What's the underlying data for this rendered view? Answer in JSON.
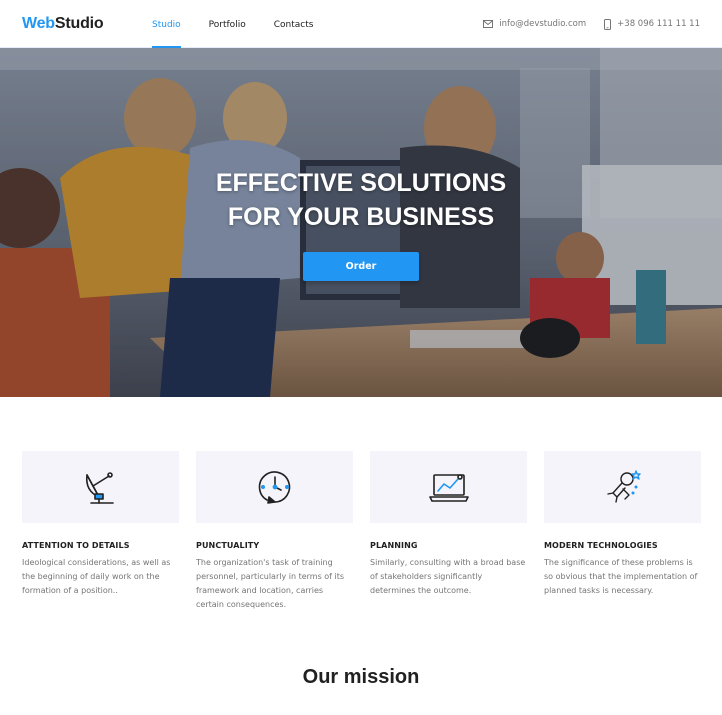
{
  "header": {
    "logo_web": "Web",
    "logo_studio": "Studio",
    "nav": [
      {
        "label": "Studio",
        "active": true
      },
      {
        "label": "Portfolio",
        "active": false
      },
      {
        "label": "Contacts",
        "active": false
      }
    ],
    "email": "info@devstudio.com",
    "phone": "+38 096 111 11 11"
  },
  "hero": {
    "title_line1": "EFFECTIVE SOLUTIONS",
    "title_line2": "FOR YOUR BUSINESS",
    "button_label": "Order"
  },
  "features": [
    {
      "icon": "satellite-dish-icon",
      "title": "ATTENTION TO DETAILS",
      "text": "Ideological considerations, as well as the beginning of daily work on the formation of a position.."
    },
    {
      "icon": "clock-icon",
      "title": "PUNCTUALITY",
      "text": "The organization's task of training personnel, particularly in terms of its framework and location, carries certain consequences."
    },
    {
      "icon": "laptop-chart-icon",
      "title": "PLANNING",
      "text": "Similarly, consulting with a broad base of stakeholders significantly determines the outcome."
    },
    {
      "icon": "astronaut-icon",
      "title": "MODERN TECHNOLOGIES",
      "text": "The significance of these problems is so obvious that the implementation of planned tasks is necessary."
    }
  ],
  "mission_title": "Our mission",
  "colors": {
    "accent": "#2196f3",
    "text": "#212121",
    "muted": "#757575",
    "feature_bg": "#f5f4fa"
  }
}
